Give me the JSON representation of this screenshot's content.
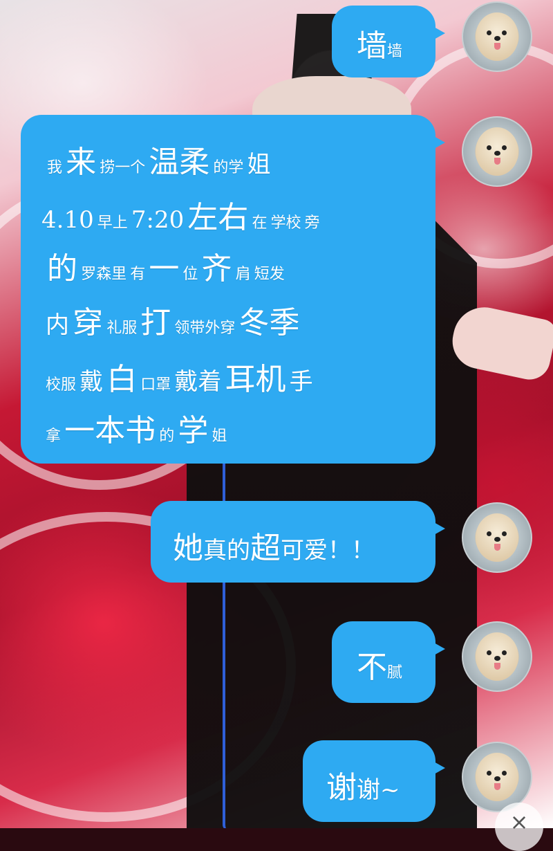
{
  "messages": {
    "m1": {
      "big": "墙",
      "small": "墙"
    },
    "m2": {
      "l1": [
        "我",
        "来",
        "捞一个",
        "温柔",
        "的学",
        "姐"
      ],
      "l2": [
        "4.10",
        "早上",
        "7:20",
        "左右",
        "在",
        "学校",
        "旁"
      ],
      "l3": [
        "的",
        "罗森里",
        "有",
        "一",
        "位",
        "齐",
        "肩",
        "短发"
      ],
      "l4": [
        "内",
        "穿",
        "礼服",
        "打",
        "领带外穿",
        "冬季"
      ],
      "l5": [
        "校服",
        "戴",
        "白",
        "口罩",
        "戴着",
        "耳机",
        "手"
      ],
      "l6": [
        "拿",
        "一本书",
        "的",
        "学",
        "姐"
      ]
    },
    "m3": {
      "a": "她",
      "b": "真的",
      "c": "超",
      "d": "可爱！！"
    },
    "m4": {
      "big": "不",
      "small": "腻"
    },
    "m5": {
      "big": "谢",
      "small": "谢~"
    }
  },
  "avatars": [
    "dog-avatar",
    "dog-avatar",
    "dog-avatar",
    "dog-avatar",
    "dog-avatar"
  ],
  "close_symbol": "×",
  "colors": {
    "bubble": "#2eaaf2",
    "text": "#ffffff"
  }
}
